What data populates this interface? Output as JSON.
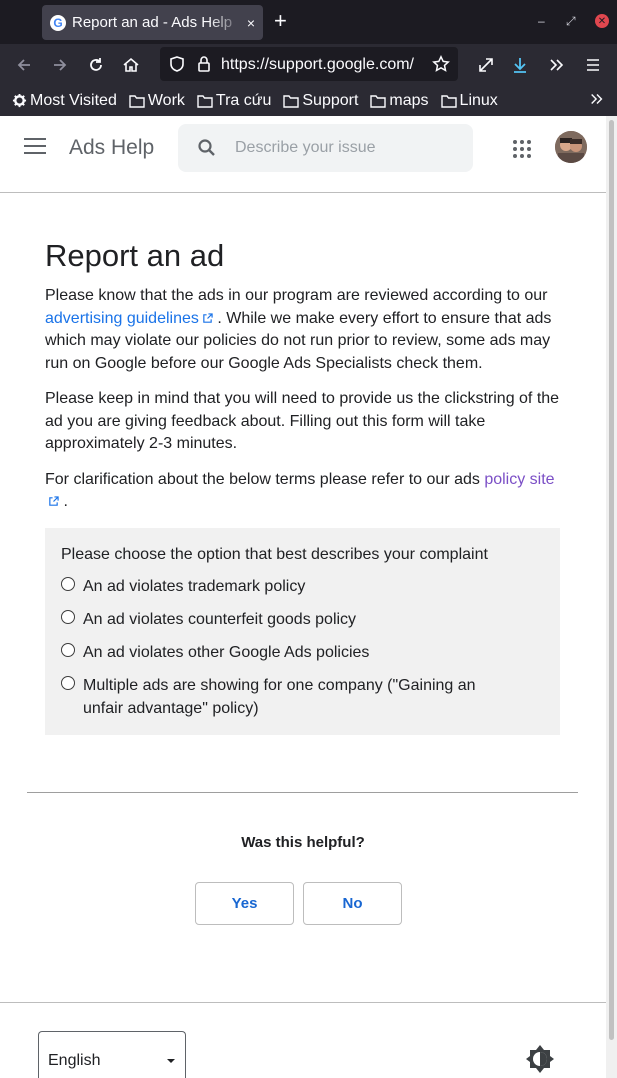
{
  "browser": {
    "tab_title": "Report an ad - Ads Help",
    "tab_close": "×",
    "new_tab": "+",
    "window_controls": [
      "–",
      "⤢",
      "✕"
    ],
    "url": "https://support.google.com/",
    "bookmarks": [
      "Most Visited",
      "Work",
      "Tra cứu",
      "Support",
      "maps",
      "Linux"
    ],
    "icons": [
      "back-icon",
      "forward-icon",
      "reload-icon",
      "home-icon",
      "shield-icon",
      "lock-icon",
      "star-icon",
      "expand-icon",
      "download-icon",
      "overflow-icon",
      "hamburger-menu-icon",
      "gear-icon",
      "folder-icon"
    ],
    "download_color": "#54c4f4"
  },
  "header": {
    "product_name": "Ads Help",
    "search_placeholder": "Describe your issue"
  },
  "article": {
    "title": "Report an ad",
    "p1_before": "Please know that the ads in our program are reviewed according to our ",
    "p1_link": "advertising guidelines",
    "p1_after": " . While we make every effort to ensure that ads which may violate our policies do not run prior to review, some ads may run on Google before our Google Ads Specialists check them.",
    "p2": "Please keep in mind that you will need to provide us the clickstring of the ad you are giving feedback about. Filling out this form will take approximately 2-3 minutes.",
    "p3_before": "For clarification about the below terms please refer to our ads ",
    "p3_link": "policy site",
    "p3_after": " ."
  },
  "form": {
    "question": "Please choose the option that best describes your complaint",
    "options": [
      "An ad violates trademark policy",
      "An ad violates counterfeit goods policy",
      "An ad violates other Google Ads policies",
      "Multiple ads are showing for one company (\"Gaining an unfair advantage\" policy)"
    ]
  },
  "feedback": {
    "question": "Was this helpful?",
    "yes": "Yes",
    "no": "No"
  },
  "footer": {
    "language": "English"
  },
  "colors": {
    "link": "#1a73e8",
    "visited_link": "#7b4fc6",
    "button_text": "#1967d2",
    "chrome_dark": "#1c1b22"
  }
}
